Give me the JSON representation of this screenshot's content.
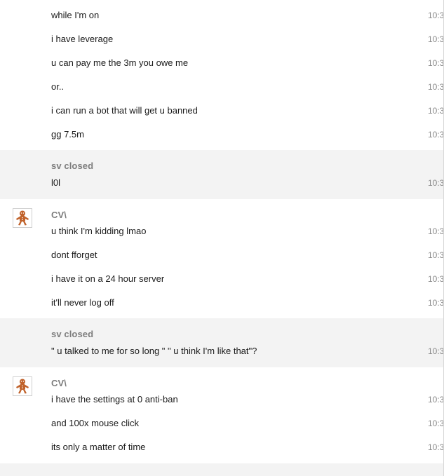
{
  "blocks": [
    {
      "sender": "",
      "avatar": false,
      "messages": [
        {
          "text": "while I'm on",
          "time": "10:3"
        },
        {
          "text": "i have leverage",
          "time": "10:3"
        },
        {
          "text": "u can pay me the 3m you owe me",
          "time": "10:3"
        },
        {
          "text": "or..",
          "time": "10:3"
        },
        {
          "text": "i can run a bot that will get u banned",
          "time": "10:3"
        },
        {
          "text": "gg 7.5m",
          "time": "10:3"
        }
      ]
    },
    {
      "sender": "sv closed",
      "avatar": false,
      "messages": [
        {
          "text": "l0l",
          "time": "10:3"
        }
      ]
    },
    {
      "sender": "CV\\",
      "avatar": true,
      "avatar_icon": "gingerbread-man-icon",
      "messages": [
        {
          "text": "u think I'm kidding lmao",
          "time": "10:3"
        },
        {
          "text": "dont fforget",
          "time": "10:3"
        },
        {
          "text": "i have it on a 24 hour server",
          "time": "10:3"
        },
        {
          "text": "it'll never log off",
          "time": "10:3"
        }
      ]
    },
    {
      "sender": "sv closed",
      "avatar": false,
      "messages": [
        {
          "text": "\" u talked to me for so long \" \" u think I'm like that\"?",
          "time": "10:3"
        }
      ]
    },
    {
      "sender": "CV\\",
      "avatar": true,
      "avatar_icon": "gingerbread-man-icon",
      "messages": [
        {
          "text": "i have the settings at 0 anti-ban",
          "time": "10:3"
        },
        {
          "text": "and 100x mouse click",
          "time": "10:3"
        },
        {
          "text": "its only a matter of time",
          "time": "10:3"
        }
      ]
    }
  ],
  "colors": {
    "alt_background": "#f3f3f3",
    "sender": "#7d7d7d",
    "timestamp": "#8a8a8a",
    "avatar_fill": "#c0622b"
  }
}
